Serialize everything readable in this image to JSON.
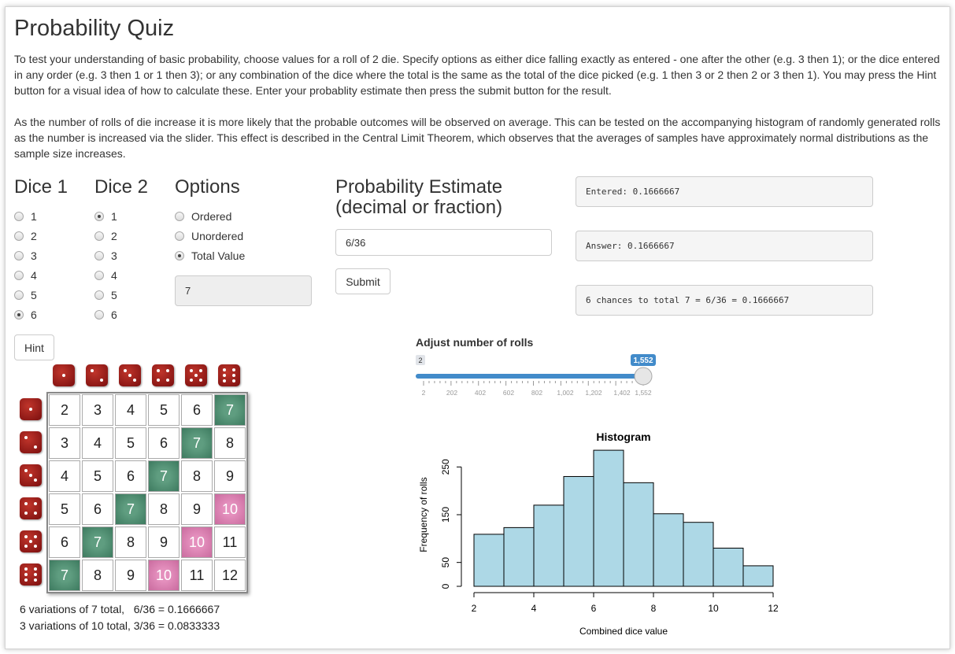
{
  "title": "Probability Quiz",
  "intro": {
    "p1": "To test your understanding of basic probability, choose values for a roll of 2 die. Specify options as either dice falling exactly as entered - one after the other (e.g. 3 then 1); or the dice entered in any order (e.g. 3 then 1 or 1 then 3); or any combination of the dice where the total is the same as the total of the dice picked (e.g. 1 then 3 or 2 then 2 or 3 then 1). You may press the Hint button for a visual idea of how to calculate these. Enter your probablity estimate then press the submit button for the result.",
    "p2": "As the number of rolls of die increase it is more likely that the probable outcomes will be observed on average. This can be tested on the accompanying histogram of randomly generated rolls as the number is increased via the slider. This effect is described in the Central Limit Theorem, which observes that the averages of samples have approximately normal distributions as the sample size increases."
  },
  "dice1": {
    "heading": "Dice 1",
    "options": [
      "1",
      "2",
      "3",
      "4",
      "5",
      "6"
    ],
    "selected": 5
  },
  "dice2": {
    "heading": "Dice 2",
    "options": [
      "1",
      "2",
      "3",
      "4",
      "5",
      "6"
    ],
    "selected": 0
  },
  "options": {
    "heading": "Options",
    "items": [
      "Ordered",
      "Unordered",
      "Total Value"
    ],
    "selected": 2,
    "total_value": "7"
  },
  "estimate": {
    "heading_line1": "Probability Estimate",
    "heading_line2": "(decimal or fraction)",
    "value": "6/36",
    "submit_label": "Submit"
  },
  "results": {
    "entered": "Entered: 0.1666667",
    "answer": "Answer: 0.1666667",
    "explanation": "6 chances to total 7 = 6/36 = 0.1666667"
  },
  "hint_label": "Hint",
  "slider": {
    "label": "Adjust number of rolls",
    "min_label": "2",
    "value_label": "1,552",
    "min": 2,
    "max": 1552,
    "value": 1552,
    "ticks": [
      "2",
      "202",
      "402",
      "602",
      "802",
      "1,002",
      "1,202",
      "1,402",
      "1,552"
    ],
    "accent": "#428bca"
  },
  "grid": {
    "rows": [
      [
        2,
        3,
        4,
        5,
        6,
        7
      ],
      [
        3,
        4,
        5,
        6,
        7,
        8
      ],
      [
        4,
        5,
        6,
        7,
        8,
        9
      ],
      [
        5,
        6,
        7,
        8,
        9,
        10
      ],
      [
        6,
        7,
        8,
        9,
        10,
        11
      ],
      [
        7,
        8,
        9,
        10,
        11,
        12
      ]
    ],
    "highlight_green": 7,
    "highlight_pink": 10,
    "green_color": "#3d7a5f",
    "pink_color": "#c96b9e",
    "die_color": "#9b1c1c"
  },
  "summary": {
    "line1": "6 variations of 7 total,   6/36 = 0.1666667",
    "line2": "3 variations of 10 total, 3/36 = 0.0833333"
  },
  "chart_data": {
    "type": "bar",
    "title": "Histogram",
    "xlabel": "Combined dice value",
    "ylabel": "Frequency of rolls",
    "bins": [
      [
        2,
        3
      ],
      [
        3,
        4
      ],
      [
        4,
        5
      ],
      [
        5,
        6
      ],
      [
        6,
        7
      ],
      [
        7,
        8
      ],
      [
        8,
        9
      ],
      [
        9,
        10
      ],
      [
        10,
        11
      ],
      [
        11,
        12
      ]
    ],
    "values": [
      109,
      123,
      170,
      230,
      285,
      217,
      152,
      134,
      80,
      43
    ],
    "xlim": [
      2,
      12
    ],
    "ylim": [
      0,
      300
    ],
    "xticks": [
      "2",
      "4",
      "6",
      "8",
      "10",
      "12"
    ],
    "yticks": [
      "0",
      "50",
      "150",
      "250"
    ],
    "bar_color": "#add8e6"
  }
}
